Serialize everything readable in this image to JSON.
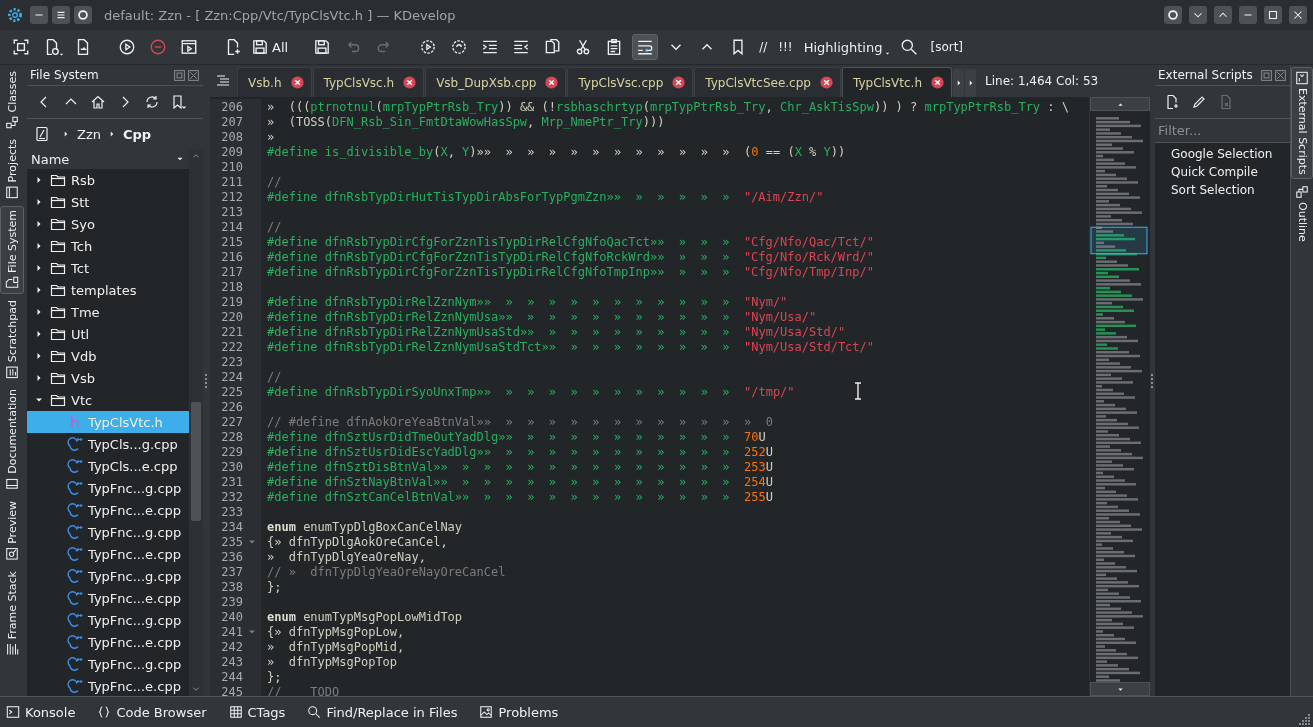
{
  "window": {
    "title": "default: Zzn - [ Zzn:Cpp/Vtc/TypClsVtc.h ] — KDevelop"
  },
  "toolbar": {
    "save_all_label": "All",
    "comment_label": "//",
    "alert_label": "!!!",
    "highlighting_label": "Highlighting",
    "sort_label": "[sort]",
    "undo": {
      "disabled": true
    },
    "redo": {
      "disabled": true
    }
  },
  "left_dock_tabs": [
    {
      "label": "Classes",
      "selected": false
    },
    {
      "label": "Projects",
      "selected": false
    },
    {
      "label": "File System",
      "selected": true
    },
    {
      "label": "Scratchpad",
      "selected": false
    },
    {
      "label": "Documentation",
      "selected": false
    },
    {
      "label": "Preview",
      "selected": false
    },
    {
      "label": "Frame Stack",
      "selected": false
    }
  ],
  "file_system": {
    "title": "File System",
    "breadcrumb": [
      {
        "label": "Zzn",
        "current": false
      },
      {
        "label": "Cpp",
        "current": true
      }
    ],
    "column": "Name",
    "tree": [
      {
        "name": "Rsb",
        "kind": "folder",
        "expanded": false,
        "selected": false
      },
      {
        "name": "Stt",
        "kind": "folder",
        "expanded": false,
        "selected": false
      },
      {
        "name": "Syo",
        "kind": "folder",
        "expanded": false,
        "selected": false
      },
      {
        "name": "Tch",
        "kind": "folder",
        "expanded": false,
        "selected": false
      },
      {
        "name": "Tct",
        "kind": "folder",
        "expanded": false,
        "selected": false
      },
      {
        "name": "templates",
        "kind": "folder",
        "expanded": false,
        "selected": false
      },
      {
        "name": "Tme",
        "kind": "folder",
        "expanded": false,
        "selected": false
      },
      {
        "name": "Utl",
        "kind": "folder",
        "expanded": false,
        "selected": false
      },
      {
        "name": "Vdb",
        "kind": "folder",
        "expanded": false,
        "selected": false
      },
      {
        "name": "Vsb",
        "kind": "folder",
        "expanded": false,
        "selected": false
      },
      {
        "name": "Vtc",
        "kind": "folder",
        "expanded": true,
        "selected": false,
        "children": [
          {
            "name": "TypClsVtc.h",
            "kind": "header",
            "selected": true
          },
          {
            "name": "TypCls...g.cpp",
            "kind": "source",
            "selected": false
          },
          {
            "name": "TypCls...e.cpp",
            "kind": "source",
            "selected": false
          },
          {
            "name": "TypFnc...g.cpp",
            "kind": "source",
            "selected": false
          },
          {
            "name": "TypFnc...e.cpp",
            "kind": "source",
            "selected": false
          },
          {
            "name": "TypFnc...g.cpp",
            "kind": "source",
            "selected": false
          },
          {
            "name": "TypFnc...e.cpp",
            "kind": "source",
            "selected": false
          },
          {
            "name": "TypFnc...g.cpp",
            "kind": "source",
            "selected": false
          },
          {
            "name": "TypFnc...e.cpp",
            "kind": "source",
            "selected": false
          },
          {
            "name": "TypFnc...g.cpp",
            "kind": "source",
            "selected": false
          },
          {
            "name": "TypFnc...e.cpp",
            "kind": "source",
            "selected": false
          },
          {
            "name": "TypFnc...g.cpp",
            "kind": "source",
            "selected": false
          },
          {
            "name": "TypFnc...e.cpp",
            "kind": "source",
            "selected": false
          }
        ]
      }
    ]
  },
  "editor": {
    "tabs": [
      {
        "label": "Vsb.h",
        "selected": false
      },
      {
        "label": "TypClsVsc.h",
        "selected": false
      },
      {
        "label": "Vsb_DupXsb.cpp",
        "selected": false
      },
      {
        "label": "TypClsVsc.cpp",
        "selected": false
      },
      {
        "label": "TypClsVtcSee.cpp",
        "selected": false
      },
      {
        "label": "TypClsVtc.h",
        "selected": true
      }
    ],
    "cursor_position": "Line: 1,464 Col: 53",
    "lines": [
      {
        "number": "206",
        "segments": [
          {
            "kind": "plain",
            "text": "»  ((("
          },
          {
            "kind": "directive",
            "text": "ptrnotnul"
          },
          {
            "kind": "plain",
            "text": "("
          },
          {
            "kind": "directive",
            "text": "mrpTypPtrRsb_Try"
          },
          {
            "kind": "plain",
            "text": ")) && (!"
          },
          {
            "kind": "directive",
            "text": "rsbhaschrtyp"
          },
          {
            "kind": "plain",
            "text": "("
          },
          {
            "kind": "directive",
            "text": "mrpTypPtrRsb_Try"
          },
          {
            "kind": "plain",
            "text": ", "
          },
          {
            "kind": "directive",
            "text": "Chr_AskTisSpw"
          },
          {
            "kind": "plain",
            "text": ")) ) ? "
          },
          {
            "kind": "directive",
            "text": "mrpTypPtrRsb_Try"
          },
          {
            "kind": "plain",
            "text": " : \\"
          }
        ]
      },
      {
        "number": "207",
        "segments": [
          {
            "kind": "plain",
            "text": "»  (TOSS("
          },
          {
            "kind": "directive",
            "text": "DFN_Rsb_Sin_FmtDtaWowHasSpw"
          },
          {
            "kind": "plain",
            "text": ", "
          },
          {
            "kind": "directive",
            "text": "Mrp_NmePtr_Try"
          },
          {
            "kind": "plain",
            "text": ")))"
          }
        ]
      },
      {
        "number": "208",
        "segments": [
          {
            "kind": "plain",
            "text": "»"
          }
        ]
      },
      {
        "number": "209",
        "segments": [
          {
            "kind": "directive",
            "text": "#define is_divisible_by"
          },
          {
            "kind": "plain",
            "text": "("
          },
          {
            "kind": "directive",
            "text": "X"
          },
          {
            "kind": "plain",
            "text": ", "
          },
          {
            "kind": "directive",
            "text": "Y"
          },
          {
            "kind": "plain",
            "text": ")»»  »  »  »  »  »  »  »  »  »  »  »  ("
          },
          {
            "kind": "number",
            "text": "0"
          },
          {
            "kind": "plain",
            "text": " == ("
          },
          {
            "kind": "directive",
            "text": "X"
          },
          {
            "kind": "plain",
            "text": " % "
          },
          {
            "kind": "directive",
            "text": "Y"
          },
          {
            "kind": "plain",
            "text": "))"
          }
        ]
      },
      {
        "number": "210"
      },
      {
        "number": "211",
        "segments": [
          {
            "kind": "comment",
            "text": "//"
          }
        ]
      },
      {
        "number": "212",
        "segments": [
          {
            "kind": "directive",
            "text": "#define dfnRsbTypDirHutTisTypDirAbsForTypPgmZzn»»  »  »  »  »  »  "
          },
          {
            "kind": "string",
            "text": "\"/Aim/Zzn/\""
          }
        ]
      },
      {
        "number": "213"
      },
      {
        "number": "214",
        "segments": [
          {
            "kind": "comment",
            "text": "//"
          }
        ]
      },
      {
        "number": "215",
        "segments": [
          {
            "kind": "directive",
            "text": "#define dfnRsbTypDirCfgForZznTisTypDirRelCfgNfoQacTct»»  »  »  »  "
          },
          {
            "kind": "string",
            "text": "\"Cfg/Nfo/Qac/Tct/\""
          }
        ]
      },
      {
        "number": "216",
        "segments": [
          {
            "kind": "directive",
            "text": "#define dfnRsbTypDirCfgForZznTisTypDirRelCfgNfoRckWrd»»  »  »  »  "
          },
          {
            "kind": "string",
            "text": "\"Cfg/Nfo/Rck/Wrd/\""
          }
        ]
      },
      {
        "number": "217",
        "segments": [
          {
            "kind": "directive",
            "text": "#define dfnRsbTypDirCfgForZznTisTypDirRelCfgNfoTmpInp»»  »  »  »  "
          },
          {
            "kind": "string",
            "text": "\"Cfg/Nfo/Tmp/Inp/\""
          }
        ]
      },
      {
        "number": "218"
      },
      {
        "number": "219",
        "segments": [
          {
            "kind": "directive",
            "text": "#define dfnRsbTypDirRelZznNym»»  »  »  »  »  »  »  »  »  »  »  »  "
          },
          {
            "kind": "string",
            "text": "\"Nym/\""
          }
        ]
      },
      {
        "number": "220",
        "segments": [
          {
            "kind": "directive",
            "text": "#define dfnRsbTypDirRelZznNymUsa»»  »  »  »  »  »  »  »  »  »  »  "
          },
          {
            "kind": "string",
            "text": "\"Nym/Usa/\""
          }
        ]
      },
      {
        "number": "221",
        "segments": [
          {
            "kind": "directive",
            "text": "#define dfnRsbTypDirRelZznNymUsaStd»»  »  »  »  »  »  »  »  »  »  "
          },
          {
            "kind": "string",
            "text": "\"Nym/Usa/Std/\""
          }
        ]
      },
      {
        "number": "222",
        "segments": [
          {
            "kind": "directive",
            "text": "#define dfnRsbTypDirRelZznNymUsaStdTct»»  »  »  »  »  »  »  »  »  "
          },
          {
            "kind": "string",
            "text": "\"Nym/Usa/Std/Tct/\""
          }
        ]
      },
      {
        "number": "223"
      },
      {
        "number": "224",
        "segments": [
          {
            "kind": "comment",
            "text": "//"
          }
        ]
      },
      {
        "number": "225",
        "segments": [
          {
            "kind": "directive",
            "text": "#define dfnRsbTypDirSyoUnxTmp»»  »  »  »  »  »  »  »  »  »  »  »  "
          },
          {
            "kind": "string",
            "text": "\"/tmp/\""
          }
        ]
      },
      {
        "number": "226"
      },
      {
        "number": "227",
        "segments": [
          {
            "kind": "comment",
            "text": "// #define dfnAokOreYeaBtnVal»»  »  »  »  »  »  »  »  »  »  »  »  »  0"
          }
        ]
      },
      {
        "number": "228",
        "segments": [
          {
            "kind": "directive",
            "text": "#define dfnSztUsrDidTmeOutYadDlg»»  »  »  »  »  »  »  »  »  »  »  "
          },
          {
            "kind": "number",
            "text": "70"
          },
          {
            "kind": "plain",
            "text": "U"
          }
        ]
      },
      {
        "number": "229",
        "segments": [
          {
            "kind": "directive",
            "text": "#define dfnSztUsrDidEscYadDlg»»  »  »  »  »  »  »  »  »  »  »  »  "
          },
          {
            "kind": "number",
            "text": "252"
          },
          {
            "kind": "plain",
            "text": "U"
          }
        ]
      },
      {
        "number": "230",
        "segments": [
          {
            "kind": "directive",
            "text": "#define dfnSztDisBtnVal»»  »  »  »  »  »  »  »  »  »  »  »  »  »  "
          },
          {
            "kind": "number",
            "text": "253"
          },
          {
            "kind": "plain",
            "text": "U"
          }
        ]
      },
      {
        "number": "231",
        "segments": [
          {
            "kind": "directive",
            "text": "#define dfnSztNayBtnVal»»  »  »  »  »  »  »  »  »  »  »  »  »  »  "
          },
          {
            "kind": "number",
            "text": "254"
          },
          {
            "kind": "plain",
            "text": "U"
          }
        ]
      },
      {
        "number": "232",
        "segments": [
          {
            "kind": "directive",
            "text": "#define dfnSztCanCelBtnVal»»  »  »  »  »  »  »  »  »  »  »  »  »  "
          },
          {
            "kind": "number",
            "text": "255"
          },
          {
            "kind": "plain",
            "text": "U"
          }
        ]
      },
      {
        "number": "233"
      },
      {
        "number": "234",
        "segments": [
          {
            "kind": "keyword",
            "text": "enum"
          },
          {
            "kind": "plain",
            "text": " enumTypDlgBoxCanCelNay"
          }
        ]
      },
      {
        "number": "235",
        "fold_marker": true,
        "segments": [
          {
            "kind": "plain",
            "text": "{» dfnTypDlgAokOreCanCel,"
          }
        ]
      },
      {
        "number": "236",
        "segments": [
          {
            "kind": "plain",
            "text": "»  dfnTypDlgYeaOreNay,"
          }
        ]
      },
      {
        "number": "237",
        "segments": [
          {
            "kind": "comment",
            "text": "// »  dfnTypDlgYeaOreNayOreCanCel"
          }
        ]
      },
      {
        "number": "238",
        "segments": [
          {
            "kind": "plain",
            "text": "};"
          }
        ]
      },
      {
        "number": "239"
      },
      {
        "number": "240",
        "segments": [
          {
            "kind": "keyword",
            "text": "enum"
          },
          {
            "kind": "plain",
            "text": " enumTypMsgPopLowMidTop"
          }
        ]
      },
      {
        "number": "241",
        "fold_marker": true,
        "segments": [
          {
            "kind": "plain",
            "text": "{» dfnTypMsgPopLow,"
          }
        ]
      },
      {
        "number": "242",
        "segments": [
          {
            "kind": "plain",
            "text": "»  dfnTypMsgPopMid,"
          }
        ]
      },
      {
        "number": "243",
        "segments": [
          {
            "kind": "plain",
            "text": "»  dfnTypMsgPopTop"
          }
        ]
      },
      {
        "number": "244",
        "segments": [
          {
            "kind": "plain",
            "text": "};"
          }
        ]
      },
      {
        "number": "245",
        "segments": [
          {
            "kind": "comment",
            "text": "//    TODO"
          }
        ]
      }
    ]
  },
  "external_scripts": {
    "title": "External Scripts",
    "filter_placeholder": "Filter...",
    "scripts": [
      "Google Selection",
      "Quick Compile",
      "Sort Selection"
    ]
  },
  "right_dock_tabs": [
    {
      "label": "External Scripts",
      "selected": true
    },
    {
      "label": "Outline",
      "selected": false
    }
  ],
  "bottom_tools": [
    {
      "label": "Konsole"
    },
    {
      "label": "Code Browser"
    },
    {
      "label": "CTags"
    },
    {
      "label": "Find/Replace in Files"
    },
    {
      "label": "Problems"
    }
  ]
}
